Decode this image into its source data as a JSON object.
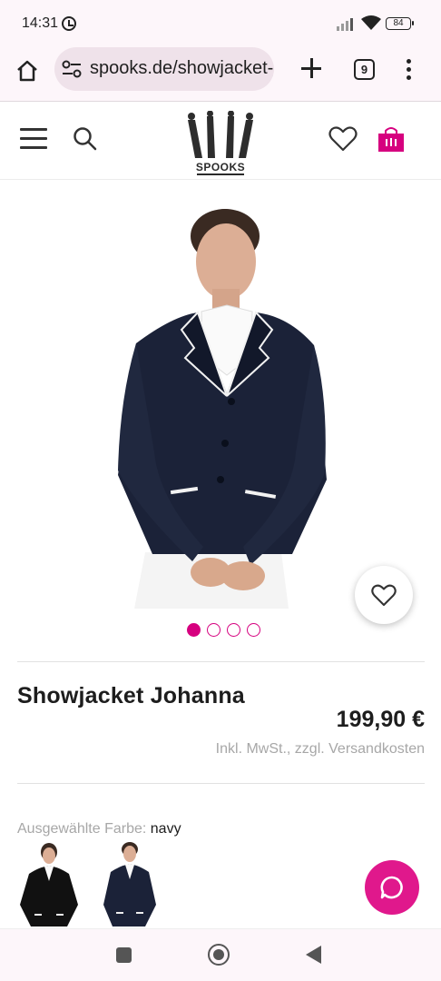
{
  "status": {
    "time": "14:31",
    "battery": "84"
  },
  "browser": {
    "url": "spooks.de/showjacket-johanna",
    "tab_count": "9"
  },
  "site": {
    "logo_text": "SPOOKS"
  },
  "product": {
    "title": "Showjacket Johanna",
    "price": "199,90 €",
    "tax_note": "Inkl. MwSt., zzgl. Versandkosten",
    "color_label": "Ausgewählte Farbe:",
    "color_value": "navy",
    "image_count": 4,
    "active_image": 1
  },
  "colors": {
    "brand": "#d6007f",
    "chat": "#e0188c",
    "jacket": "#1b2238"
  }
}
